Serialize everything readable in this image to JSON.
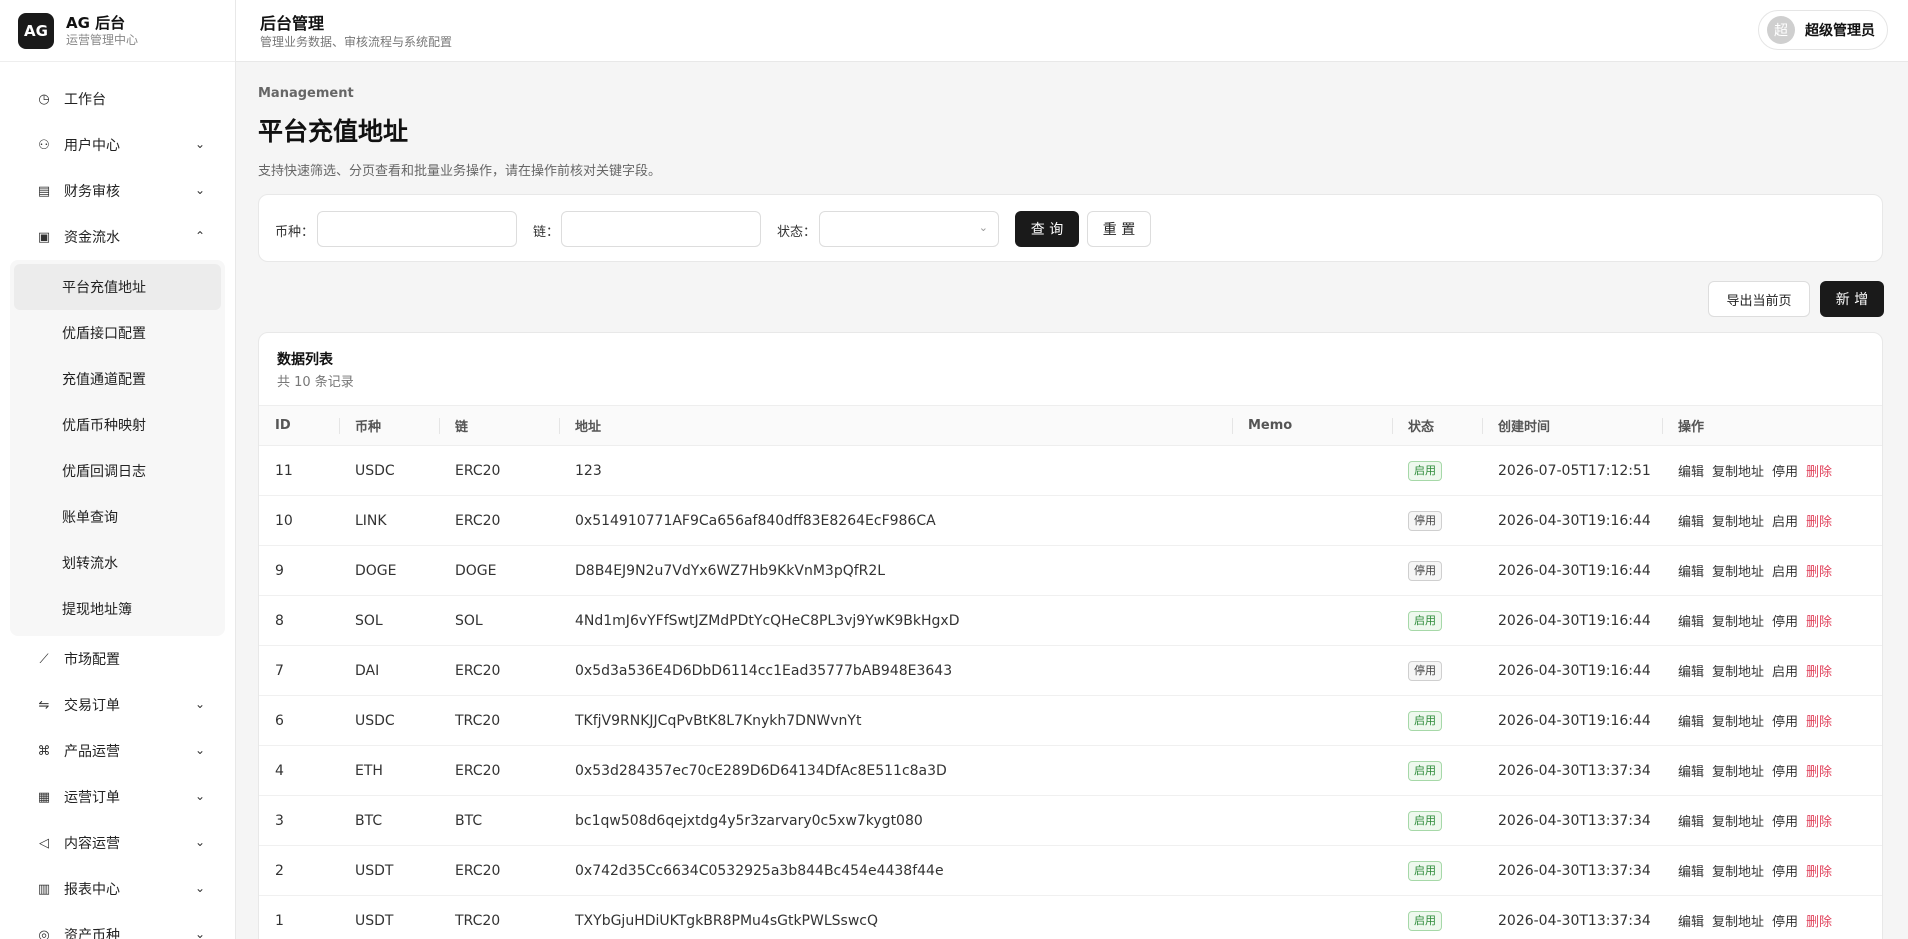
{
  "brand": {
    "logo": "AG",
    "title": "AG 后台",
    "subtitle": "运营管理中心"
  },
  "sidebar": {
    "items": [
      {
        "label": "工作台",
        "icon": "dashboard-icon",
        "glyph": "◷",
        "expandable": false
      },
      {
        "label": "用户中心",
        "icon": "users-icon",
        "glyph": "⚇",
        "expandable": true,
        "chevron": "⌄"
      },
      {
        "label": "财务审核",
        "icon": "audit-icon",
        "glyph": "▤",
        "expandable": true,
        "chevron": "⌄"
      },
      {
        "label": "资金流水",
        "icon": "wallet-icon",
        "glyph": "▣",
        "expandable": true,
        "chevron": "⌃"
      }
    ],
    "submenu": [
      {
        "label": "平台充值地址",
        "active": true
      },
      {
        "label": "优盾接口配置"
      },
      {
        "label": "充值通道配置"
      },
      {
        "label": "优盾币种映射"
      },
      {
        "label": "优盾回调日志"
      },
      {
        "label": "账单查询"
      },
      {
        "label": "划转流水"
      },
      {
        "label": "提现地址簿"
      }
    ],
    "items_after": [
      {
        "label": "市场配置",
        "icon": "trend-icon",
        "glyph": "⟋",
        "expandable": false
      },
      {
        "label": "交易订单",
        "icon": "swap-icon",
        "glyph": "⇋",
        "expandable": true,
        "chevron": "⌄"
      },
      {
        "label": "产品运营",
        "icon": "product-icon",
        "glyph": "⌘",
        "expandable": true,
        "chevron": "⌄"
      },
      {
        "label": "运营订单",
        "icon": "orders-icon",
        "glyph": "▦",
        "expandable": true,
        "chevron": "⌄"
      },
      {
        "label": "内容运营",
        "icon": "megaphone-icon",
        "glyph": "◁",
        "expandable": true,
        "chevron": "⌄"
      },
      {
        "label": "报表中心",
        "icon": "chart-icon",
        "glyph": "▥",
        "expandable": true,
        "chevron": "⌄"
      },
      {
        "label": "资产币种",
        "icon": "coin-icon",
        "glyph": "◎",
        "expandable": true,
        "chevron": "⌄"
      }
    ]
  },
  "header": {
    "title": "后台管理",
    "subtitle": "管理业务数据、审核流程与系统配置",
    "user": {
      "avatar": "超",
      "name": "超级管理员"
    }
  },
  "main": {
    "breadcrumb": "Management",
    "title": "平台充值地址",
    "description": "支持快速筛选、分页查看和批量业务操作，请在操作前核对关键字段。"
  },
  "filters": {
    "currency_label": "币种：",
    "currency_value": "",
    "chain_label": "链：",
    "chain_value": "",
    "status_label": "状态：",
    "status_value": "",
    "query_label": "查 询",
    "reset_label": "重 置"
  },
  "actions": {
    "export_label": "导出当前页",
    "add_label": "新 增"
  },
  "table": {
    "title": "数据列表",
    "count": "共 10 条记录",
    "columns": [
      "ID",
      "币种",
      "链",
      "地址",
      "Memo",
      "状态",
      "创建时间",
      "操作"
    ],
    "rows": [
      {
        "id": "11",
        "currency": "USDC",
        "chain": "ERC20",
        "address": "123",
        "memo": "",
        "status": "启用",
        "enabled": true,
        "created": "2026-07-05T17:12:51",
        "toggle": "停用"
      },
      {
        "id": "10",
        "currency": "LINK",
        "chain": "ERC20",
        "address": "0x514910771AF9Ca656af840dff83E8264EcF986CA",
        "memo": "",
        "status": "停用",
        "enabled": false,
        "created": "2026-04-30T19:16:44",
        "toggle": "启用"
      },
      {
        "id": "9",
        "currency": "DOGE",
        "chain": "DOGE",
        "address": "D8B4EJ9N2u7VdYx6WZ7Hb9KkVnM3pQfR2L",
        "memo": "",
        "status": "停用",
        "enabled": false,
        "created": "2026-04-30T19:16:44",
        "toggle": "启用"
      },
      {
        "id": "8",
        "currency": "SOL",
        "chain": "SOL",
        "address": "4Nd1mJ6vYFfSwtJZMdPDtYcQHeC8PL3vj9YwK9BkHgxD",
        "memo": "",
        "status": "启用",
        "enabled": true,
        "created": "2026-04-30T19:16:44",
        "toggle": "停用"
      },
      {
        "id": "7",
        "currency": "DAI",
        "chain": "ERC20",
        "address": "0x5d3a536E4D6DbD6114cc1Ead35777bAB948E3643",
        "memo": "",
        "status": "停用",
        "enabled": false,
        "created": "2026-04-30T19:16:44",
        "toggle": "启用"
      },
      {
        "id": "6",
        "currency": "USDC",
        "chain": "TRC20",
        "address": "TKfjV9RNKJJCqPvBtK8L7Knykh7DNWvnYt",
        "memo": "",
        "status": "启用",
        "enabled": true,
        "created": "2026-04-30T19:16:44",
        "toggle": "停用"
      },
      {
        "id": "4",
        "currency": "ETH",
        "chain": "ERC20",
        "address": "0x53d284357ec70cE289D6D64134DfAc8E511c8a3D",
        "memo": "",
        "status": "启用",
        "enabled": true,
        "created": "2026-04-30T13:37:34",
        "toggle": "停用"
      },
      {
        "id": "3",
        "currency": "BTC",
        "chain": "BTC",
        "address": "bc1qw508d6qejxtdg4y5r3zarvary0c5xw7kygt080",
        "memo": "",
        "status": "启用",
        "enabled": true,
        "created": "2026-04-30T13:37:34",
        "toggle": "停用"
      },
      {
        "id": "2",
        "currency": "USDT",
        "chain": "ERC20",
        "address": "0x742d35Cc6634C0532925a3b844Bc454e4438f44e",
        "memo": "",
        "status": "启用",
        "enabled": true,
        "created": "2026-04-30T13:37:34",
        "toggle": "停用"
      },
      {
        "id": "1",
        "currency": "USDT",
        "chain": "TRC20",
        "address": "TXYbGjuHDiUKTgkBR8PMu4sGtkPWLSswcQ",
        "memo": "",
        "status": "启用",
        "enabled": true,
        "created": "2026-04-30T13:37:34",
        "toggle": "停用"
      }
    ],
    "ops": {
      "edit": "编辑",
      "copy": "复制地址",
      "delete": "删除"
    }
  },
  "colors": {
    "primary": "#1a1a1a",
    "danger": "#e0435c",
    "success": "#2e8b3a"
  }
}
